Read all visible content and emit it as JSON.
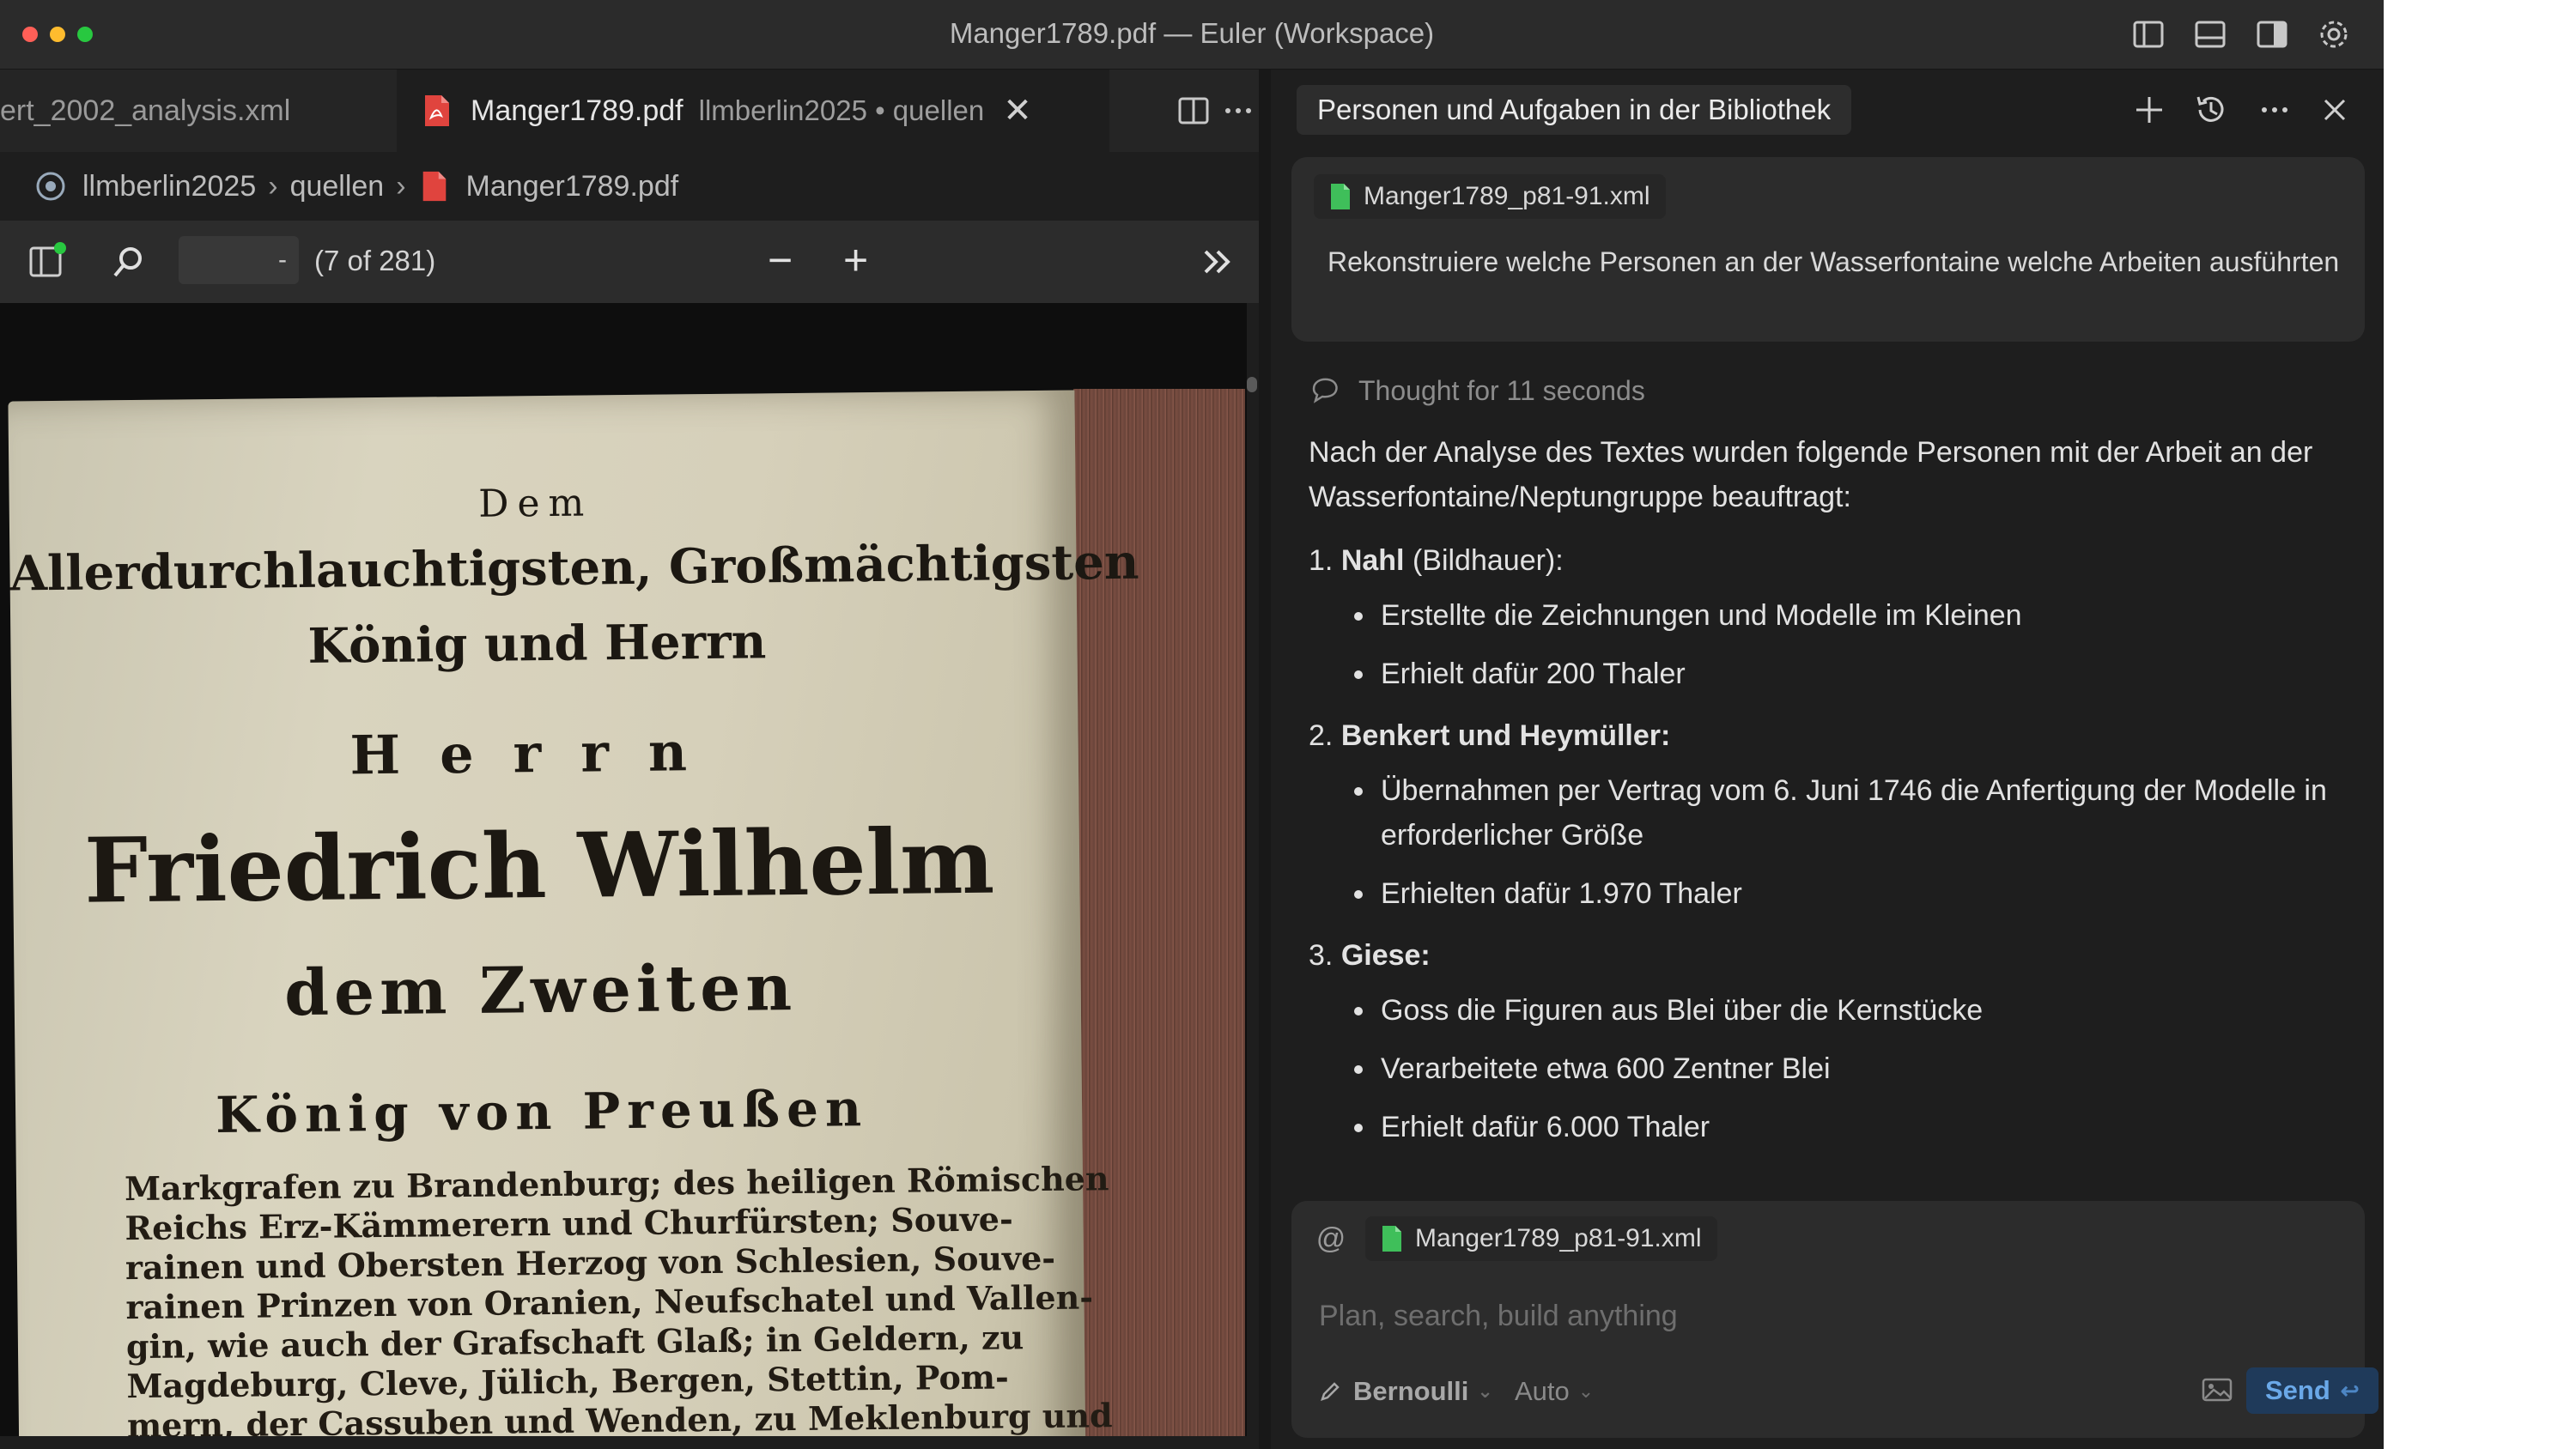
{
  "window": {
    "title": "Manger1789.pdf — Euler (Workspace)"
  },
  "editor": {
    "tabs": [
      {
        "label": "ert_2002_analysis.xml",
        "active": false
      },
      {
        "label": "Manger1789.pdf",
        "description": "llmberlin2025 • quellen",
        "active": true
      }
    ],
    "breadcrumb": [
      "llmberlin2025",
      "quellen",
      "Manger1789.pdf"
    ],
    "pdf_toolbar": {
      "page_input_value": "-",
      "page_count": "(7 of 281)",
      "zoom_out": "−",
      "zoom_in": "+"
    },
    "page_text": {
      "line1": "Dem",
      "line2": "Allerdurchlauchtigsten, Großmächtigsten",
      "line3": "König und Herrn",
      "line4": "Herrn",
      "line5": "Friedrich Wilhelm",
      "line6": "dem Zweiten",
      "line7": "König von Preußen",
      "body": [
        "Markgrafen zu Brandenburg; des heiligen Römischen",
        "Reichs Erz-Kämmerern und Churfürsten; Souve-",
        "rainen und Obersten Herzog von Schlesien, Souve-",
        "rainen Prinzen von Oranien, Neufschatel und Vallen-",
        "gin, wie auch der Grafschaft Glaß; in Geldern, zu",
        "Magdeburg, Cleve, Jülich, Bergen, Stettin, Pom-",
        "mern, der Cassuben und Wenden, zu Meklenburg und"
      ]
    }
  },
  "chat": {
    "title": "Personen und Aufgaben in der Bibliothek",
    "user_message": {
      "attachment": "Manger1789_p81-91.xml",
      "text": "Rekonstruiere welche Personen an der  Wasserfontaine welche Arbeiten ausführten"
    },
    "thought": "Thought for 11 seconds",
    "answer": {
      "intro": "Nach der Analyse des Textes wurden folgende Personen mit der Arbeit an der Wasserfontaine/Neptungruppe beauftragt:",
      "items": [
        {
          "number": "1.",
          "name": "Nahl",
          "role": " (Bildhauer):",
          "bullets": [
            "Erstellte die Zeichnungen und Modelle im Kleinen",
            "Erhielt dafür 200 Thaler"
          ]
        },
        {
          "number": "2.",
          "name": "Benkert und Heymüller:",
          "role": "",
          "bullets": [
            "Übernahmen per Vertrag vom 6. Juni 1746 die Anfertigung der Modelle in erforderlicher Größe",
            "Erhielten dafür 1.970 Thaler"
          ]
        },
        {
          "number": "3.",
          "name": "Giese:",
          "role": "",
          "bullets": [
            "Goss die Figuren aus Blei über die Kernstücke",
            "Verarbeitete etwa 600 Zentner Blei",
            "Erhielt dafür 6.000 Thaler"
          ]
        }
      ]
    },
    "composer": {
      "at_symbol": "@",
      "attachment": "Manger1789_p81-91.xml",
      "placeholder": "Plan, search, build anything",
      "model": "Bernoulli",
      "mode": "Auto",
      "send_label": "Send",
      "send_key": "↩"
    }
  },
  "colors": {
    "accent_blue": "#6aa8e8",
    "pdf_red": "#e0443e",
    "xml_green": "#3fbf5a"
  }
}
